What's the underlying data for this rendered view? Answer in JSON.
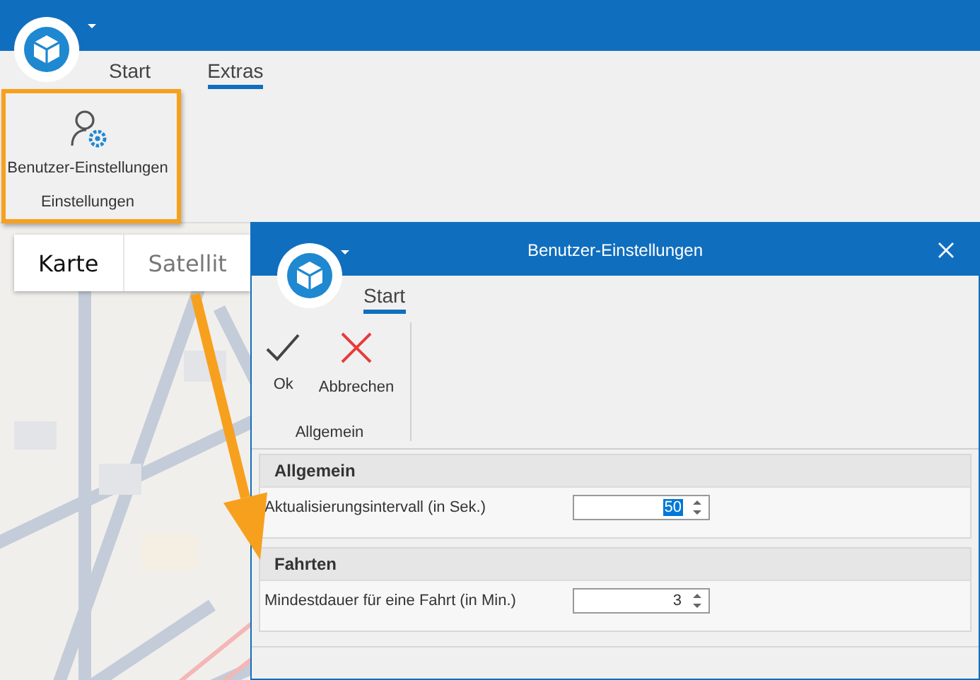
{
  "app": {
    "tabs": [
      {
        "label": "Start",
        "selected": false
      },
      {
        "label": "Extras",
        "selected": true
      }
    ],
    "ribbon_group": {
      "buttons": [
        {
          "label": "Benutzer-Einstellungen",
          "kind": "user-settings"
        }
      ],
      "caption": "Einstellungen"
    }
  },
  "map": {
    "view_toggle": [
      {
        "label": "Karte",
        "selected": true
      },
      {
        "label": "Satellit",
        "selected": false
      }
    ]
  },
  "dialog": {
    "title": "Benutzer-Einstellungen",
    "tabs": [
      {
        "label": "Start",
        "selected": true
      }
    ],
    "ribbon_group": {
      "buttons": [
        {
          "label": "Ok",
          "kind": "ok"
        },
        {
          "label": "Abbrechen",
          "kind": "cancel"
        }
      ],
      "caption": "Allgemein"
    },
    "sections": [
      {
        "title": "Allgemein",
        "fields": [
          {
            "label": "Aktualisierungsintervall (in Sek.)",
            "value": "50",
            "selected": true
          }
        ]
      },
      {
        "title": "Fahrten",
        "fields": [
          {
            "label": "Mindestdauer für eine Fahrt (in Min.)",
            "value": "3",
            "selected": false
          }
        ]
      }
    ]
  }
}
